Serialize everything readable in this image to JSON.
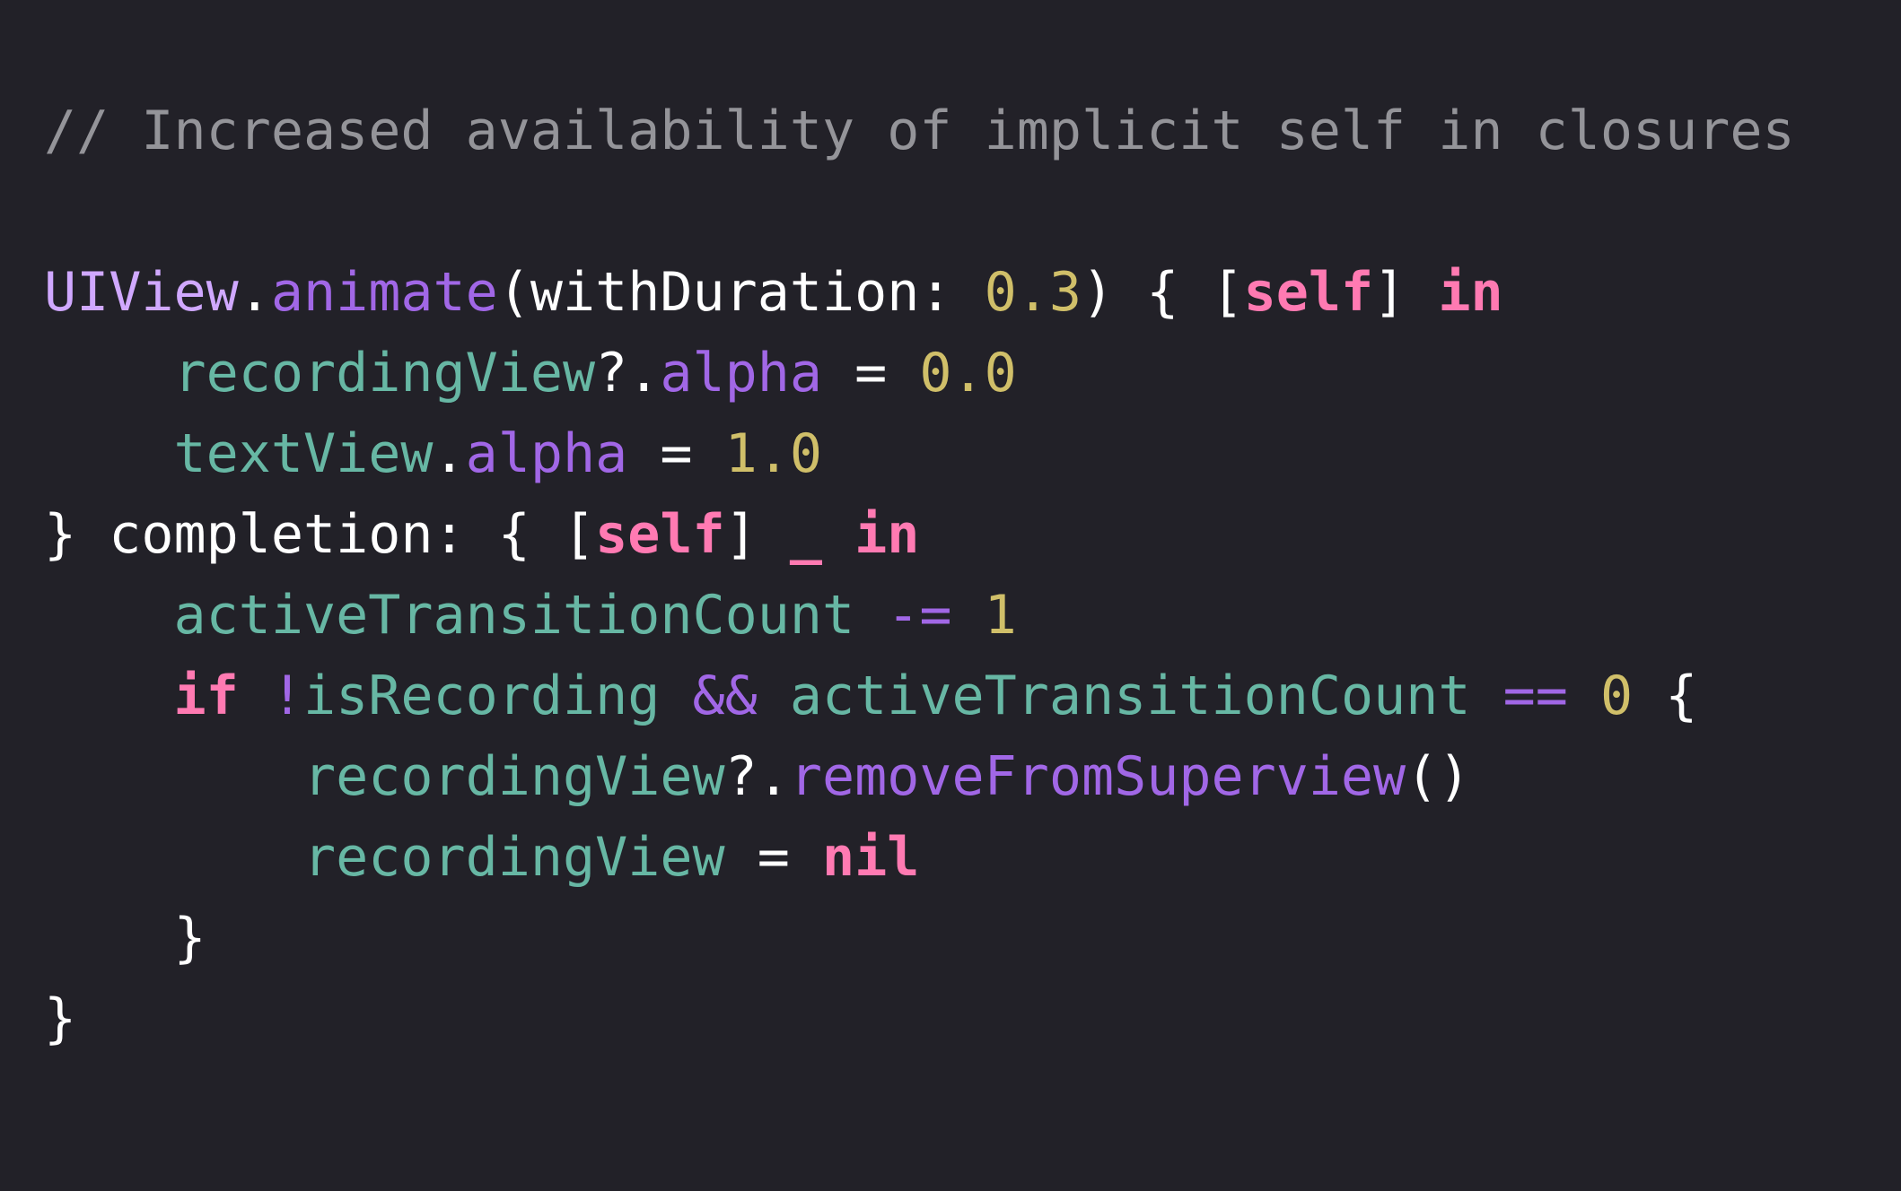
{
  "colors": {
    "background": "#222128",
    "comment": "#949499",
    "type": "#D0A8FF",
    "method": "#A167E6",
    "property": "#67B7A4",
    "number": "#D0BF69",
    "keyword": "#FF7AB2",
    "plain": "#FFFFFF"
  },
  "code": {
    "comment": "// Increased availability of implicit self in closures",
    "lines": [
      {
        "tokens": [
          {
            "text": "UIView",
            "kind": "type"
          },
          {
            "text": ".",
            "kind": "plain"
          },
          {
            "text": "animate",
            "kind": "method"
          },
          {
            "text": "(withDuration: ",
            "kind": "plain"
          },
          {
            "text": "0.3",
            "kind": "number"
          },
          {
            "text": ") { [",
            "kind": "plain"
          },
          {
            "text": "self",
            "kind": "keyword"
          },
          {
            "text": "] ",
            "kind": "plain"
          },
          {
            "text": "in",
            "kind": "keyword"
          }
        ]
      },
      {
        "tokens": [
          {
            "text": "    ",
            "kind": "plain"
          },
          {
            "text": "recordingView",
            "kind": "prop"
          },
          {
            "text": "?.",
            "kind": "plain"
          },
          {
            "text": "alpha",
            "kind": "method"
          },
          {
            "text": " = ",
            "kind": "plain"
          },
          {
            "text": "0.0",
            "kind": "number"
          }
        ]
      },
      {
        "tokens": [
          {
            "text": "    ",
            "kind": "plain"
          },
          {
            "text": "textView",
            "kind": "prop"
          },
          {
            "text": ".",
            "kind": "plain"
          },
          {
            "text": "alpha",
            "kind": "method"
          },
          {
            "text": " = ",
            "kind": "plain"
          },
          {
            "text": "1.0",
            "kind": "number"
          }
        ]
      },
      {
        "tokens": [
          {
            "text": "} completion: { [",
            "kind": "plain"
          },
          {
            "text": "self",
            "kind": "keyword"
          },
          {
            "text": "] ",
            "kind": "plain"
          },
          {
            "text": "_",
            "kind": "keyword"
          },
          {
            "text": " ",
            "kind": "plain"
          },
          {
            "text": "in",
            "kind": "keyword"
          }
        ]
      },
      {
        "tokens": [
          {
            "text": "    ",
            "kind": "plain"
          },
          {
            "text": "activeTransitionCount",
            "kind": "prop"
          },
          {
            "text": " ",
            "kind": "plain"
          },
          {
            "text": "-=",
            "kind": "method"
          },
          {
            "text": " ",
            "kind": "plain"
          },
          {
            "text": "1",
            "kind": "number"
          }
        ]
      },
      {
        "tokens": [
          {
            "text": "    ",
            "kind": "plain"
          },
          {
            "text": "if",
            "kind": "keyword"
          },
          {
            "text": " ",
            "kind": "plain"
          },
          {
            "text": "!",
            "kind": "method"
          },
          {
            "text": "isRecording",
            "kind": "prop"
          },
          {
            "text": " ",
            "kind": "plain"
          },
          {
            "text": "&&",
            "kind": "method"
          },
          {
            "text": " ",
            "kind": "plain"
          },
          {
            "text": "activeTransitionCount",
            "kind": "prop"
          },
          {
            "text": " ",
            "kind": "plain"
          },
          {
            "text": "==",
            "kind": "method"
          },
          {
            "text": " ",
            "kind": "plain"
          },
          {
            "text": "0",
            "kind": "number"
          },
          {
            "text": " {",
            "kind": "plain"
          }
        ]
      },
      {
        "tokens": [
          {
            "text": "        ",
            "kind": "plain"
          },
          {
            "text": "recordingView",
            "kind": "prop"
          },
          {
            "text": "?.",
            "kind": "plain"
          },
          {
            "text": "removeFromSuperview",
            "kind": "method"
          },
          {
            "text": "()",
            "kind": "plain"
          }
        ]
      },
      {
        "tokens": [
          {
            "text": "        ",
            "kind": "plain"
          },
          {
            "text": "recordingView",
            "kind": "prop"
          },
          {
            "text": " = ",
            "kind": "plain"
          },
          {
            "text": "nil",
            "kind": "keyword"
          }
        ]
      },
      {
        "tokens": [
          {
            "text": "    }",
            "kind": "plain"
          }
        ]
      },
      {
        "tokens": [
          {
            "text": "}",
            "kind": "plain"
          }
        ]
      }
    ]
  }
}
